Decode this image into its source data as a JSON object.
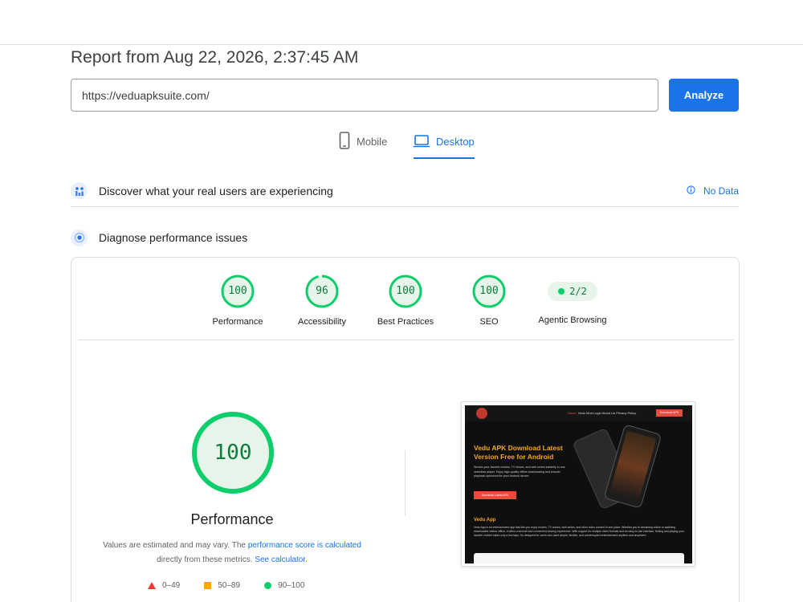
{
  "report": {
    "title": "Report from Aug 22, 2026, 2:37:45 AM",
    "url_value": "https://veduapksuite.com/",
    "analyze_label": "Analyze"
  },
  "device_tabs": {
    "mobile_label": "Mobile",
    "desktop_label": "Desktop",
    "selected": "Desktop"
  },
  "sections": {
    "real_users_title": "Discover what your real users are experiencing",
    "no_data_label": "No Data",
    "diagnose_title": "Diagnose performance issues"
  },
  "scores": [
    {
      "label": "Performance",
      "value": "100",
      "fraction": 1.0
    },
    {
      "label": "Accessibility",
      "value": "96",
      "fraction": 0.96
    },
    {
      "label": "Best Practices",
      "value": "100",
      "fraction": 1.0
    },
    {
      "label": "SEO",
      "value": "100",
      "fraction": 1.0
    }
  ],
  "agentic": {
    "label": "Agentic Browsing",
    "value": "2/2"
  },
  "main_score": {
    "value": "100",
    "fraction": 1.0,
    "label": "Performance"
  },
  "note": {
    "prefix": "Values are estimated and may vary. The ",
    "link1": "performance score is calculated",
    "middle": " directly from these metrics. ",
    "link2": "See calculator",
    "suffix": "."
  },
  "legend": {
    "fail": "0–49",
    "average": "50–89",
    "pass": "90–100"
  },
  "screenshot": {
    "nav_home": "Home",
    "nav_links": "Vedu Mod   Login   About Us   Privacy Policy",
    "nav_button": "Download APK",
    "hero_title": "Vedu APK Download Latest Version Free for Android",
    "hero_desc": "Stream your favorite movies, TV shows, and web series instantly in one seamless player. Enjoy high-quality offline downloading and smooth playback optimized for your Android device.",
    "hero_button": "Download Latest APK",
    "app_title": "Vedu App",
    "app_desc": "Vedu App is an entertainment app that lets you enjoy movies, TV shows, web series, and other video content in one place. Whether you're streaming online or watching downloaded videos offline, it offers a smooth and convenient viewing experience. With support for multiple video formats and an easy-to-use interface, finding and playing your favorite content takes only a few taps. It's designed for users who want simple, flexible, and uninterrupted entertainment anytime and anywhere."
  },
  "colors": {
    "pass": "#0cce6b",
    "pass_text": "#0c7c3c",
    "pass_bg": "#e6f4ea",
    "average": "#ffa400",
    "fail": "#ff3333",
    "accent": "#1a73e8"
  }
}
